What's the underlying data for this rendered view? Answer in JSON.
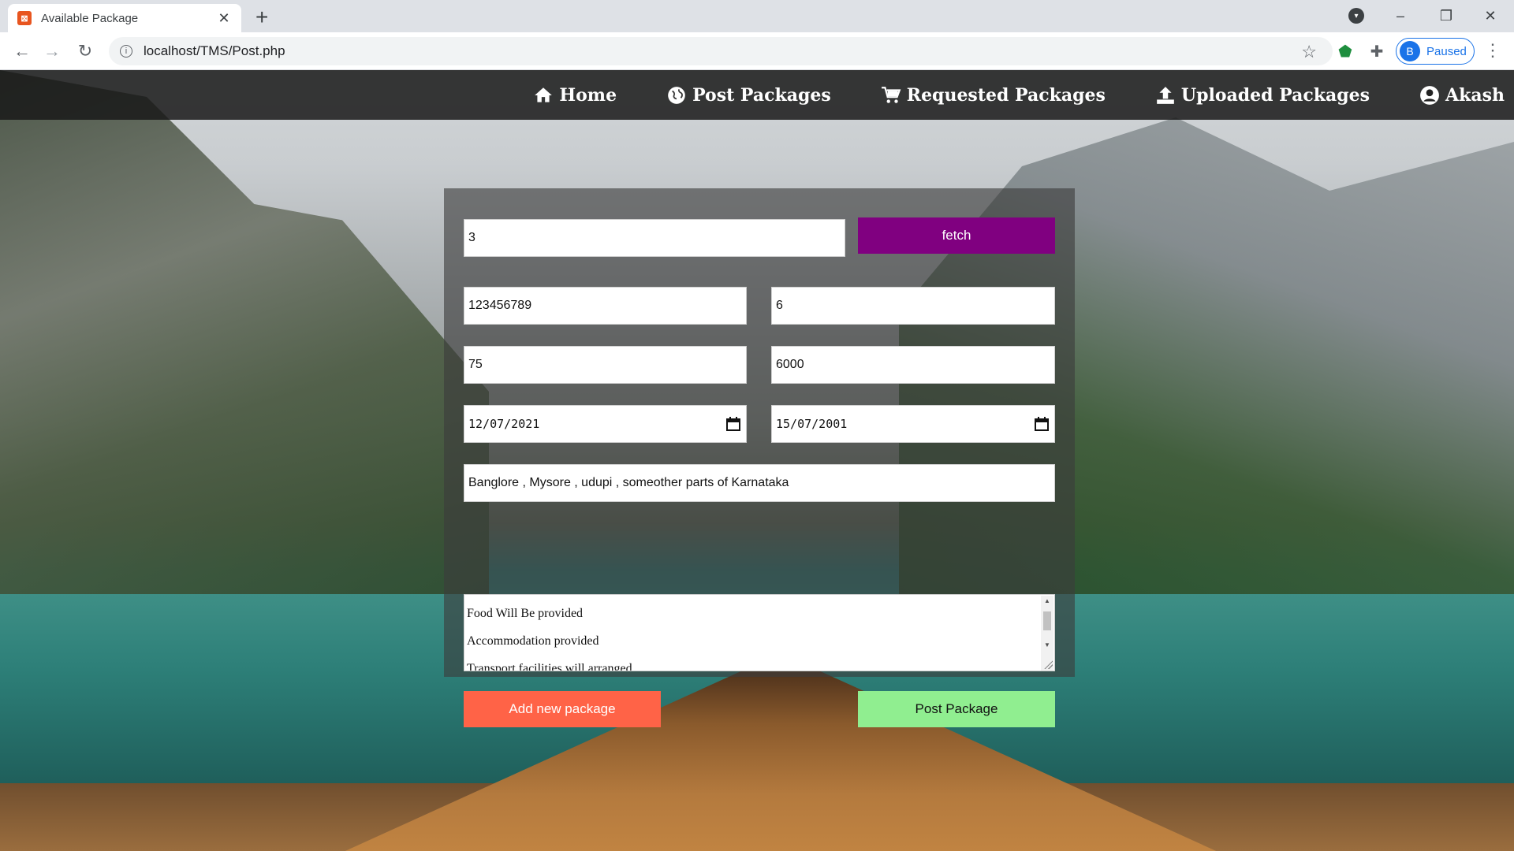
{
  "browser": {
    "tab_title": "Available Package",
    "new_tab_symbol": "+",
    "tab_close_symbol": "✕",
    "url": "localhost/TMS/Post.php",
    "profile_initial": "B",
    "profile_status": "Paused"
  },
  "navbar": {
    "items": [
      {
        "label": "Home",
        "icon": "home-icon"
      },
      {
        "label": "Post Packages",
        "icon": "globe-icon"
      },
      {
        "label": "Requested Packages",
        "icon": "cart-icon"
      },
      {
        "label": "Uploaded Packages",
        "icon": "upload-icon"
      },
      {
        "label": "Akash",
        "icon": "user-circle-icon"
      }
    ]
  },
  "form": {
    "package_id": "3",
    "fetch_label": "fetch",
    "field_a": "123456789",
    "field_b": "6",
    "field_c": "75",
    "field_d": "6000",
    "start_date": "12/07/2021",
    "end_date": "15/07/2001",
    "places": "Banglore , Mysore , udupi , someother parts of Karnataka",
    "description_lines": [
      "Food Will Be provided",
      "Accommodation provided",
      "Transport facilities will arranged"
    ],
    "add_label": "Add new package",
    "post_label": "Post Package"
  },
  "colors": {
    "fetch": "#800080",
    "add": "#ff6347",
    "post": "#90ee90"
  }
}
